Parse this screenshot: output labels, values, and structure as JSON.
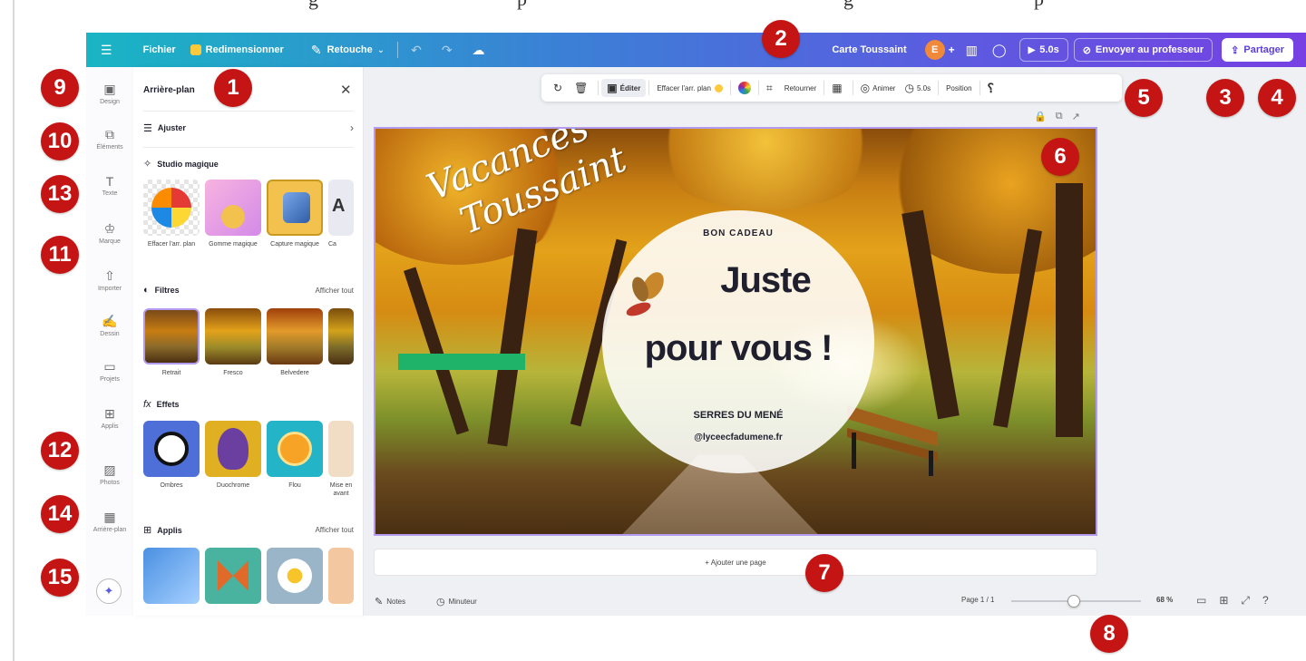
{
  "caption_fragments": [
    "g",
    "p",
    "g",
    "p"
  ],
  "topbar": {
    "menu_icon": "hamburger-icon",
    "file_label": "Fichier",
    "resize_label": "Redimensionner",
    "edit_label": "Retouche",
    "design_title": "Carte Toussaint",
    "avatar_initial": "E",
    "play_label": "5.0s",
    "send_teacher_label": "Envoyer au professeur",
    "share_label": "Partager"
  },
  "rail": {
    "items": [
      {
        "label": "Design",
        "icon": "design-icon"
      },
      {
        "label": "Éléments",
        "icon": "elements-icon"
      },
      {
        "label": "Texte",
        "icon": "text-icon"
      },
      {
        "label": "Marque",
        "icon": "brand-icon"
      },
      {
        "label": "Importer",
        "icon": "upload-icon"
      },
      {
        "label": "Dessin",
        "icon": "draw-icon"
      },
      {
        "label": "Projets",
        "icon": "folder-icon"
      },
      {
        "label": "Applis",
        "icon": "apps-icon"
      },
      {
        "label": "Photos",
        "icon": "photos-icon"
      },
      {
        "label": "Arrière-plan",
        "icon": "background-icon"
      }
    ]
  },
  "panel": {
    "title": "Arrière-plan",
    "adjust_label": "Ajuster",
    "magic_studio_label": "Studio magique",
    "magic_items": [
      "Effacer l'arr. plan",
      "Gomme magique",
      "Capture magique",
      "Ca"
    ],
    "filters_label": "Filtres",
    "filters_see_all": "Afficher tout",
    "filter_items": [
      "Retrait",
      "Fresco",
      "Belvedere",
      ""
    ],
    "effects_label": "Effets",
    "effect_items": [
      "Ombres",
      "Duochrome",
      "Flou",
      "Mise en avant"
    ],
    "apps_label": "Applis",
    "apps_see_all": "Afficher tout"
  },
  "context_toolbar": {
    "edit_label": "Éditer",
    "erase_bg_label": "Effacer l'arr. plan",
    "flip_label": "Retourner",
    "animate_label": "Animer",
    "duration_label": "5.0s",
    "position_label": "Position"
  },
  "design": {
    "script_line1": "Vacances",
    "script_line2": "Toussaint",
    "bon_cadeau": "BON CADEAU",
    "juste": "Juste",
    "pour_vous": "pour vous !",
    "serres": "SERRES DU MENÉ",
    "handle": "@lyceecfadumene.fr"
  },
  "add_page_label": "+ Ajouter une page",
  "footer": {
    "notes_label": "Notes",
    "timer_label": "Minuteur",
    "page_label": "Page 1 / 1",
    "zoom_label": "68 %",
    "zoom_fraction": 0.48
  },
  "markers": [
    "1",
    "2",
    "3",
    "4",
    "5",
    "6",
    "7",
    "8",
    "9",
    "10",
    "13",
    "11",
    "12",
    "14",
    "15"
  ],
  "colors": {
    "topbar_start": "#19b5c4",
    "topbar_end": "#7640e2",
    "marker_red": "#c41414",
    "selection_purple": "#b39cf0"
  }
}
